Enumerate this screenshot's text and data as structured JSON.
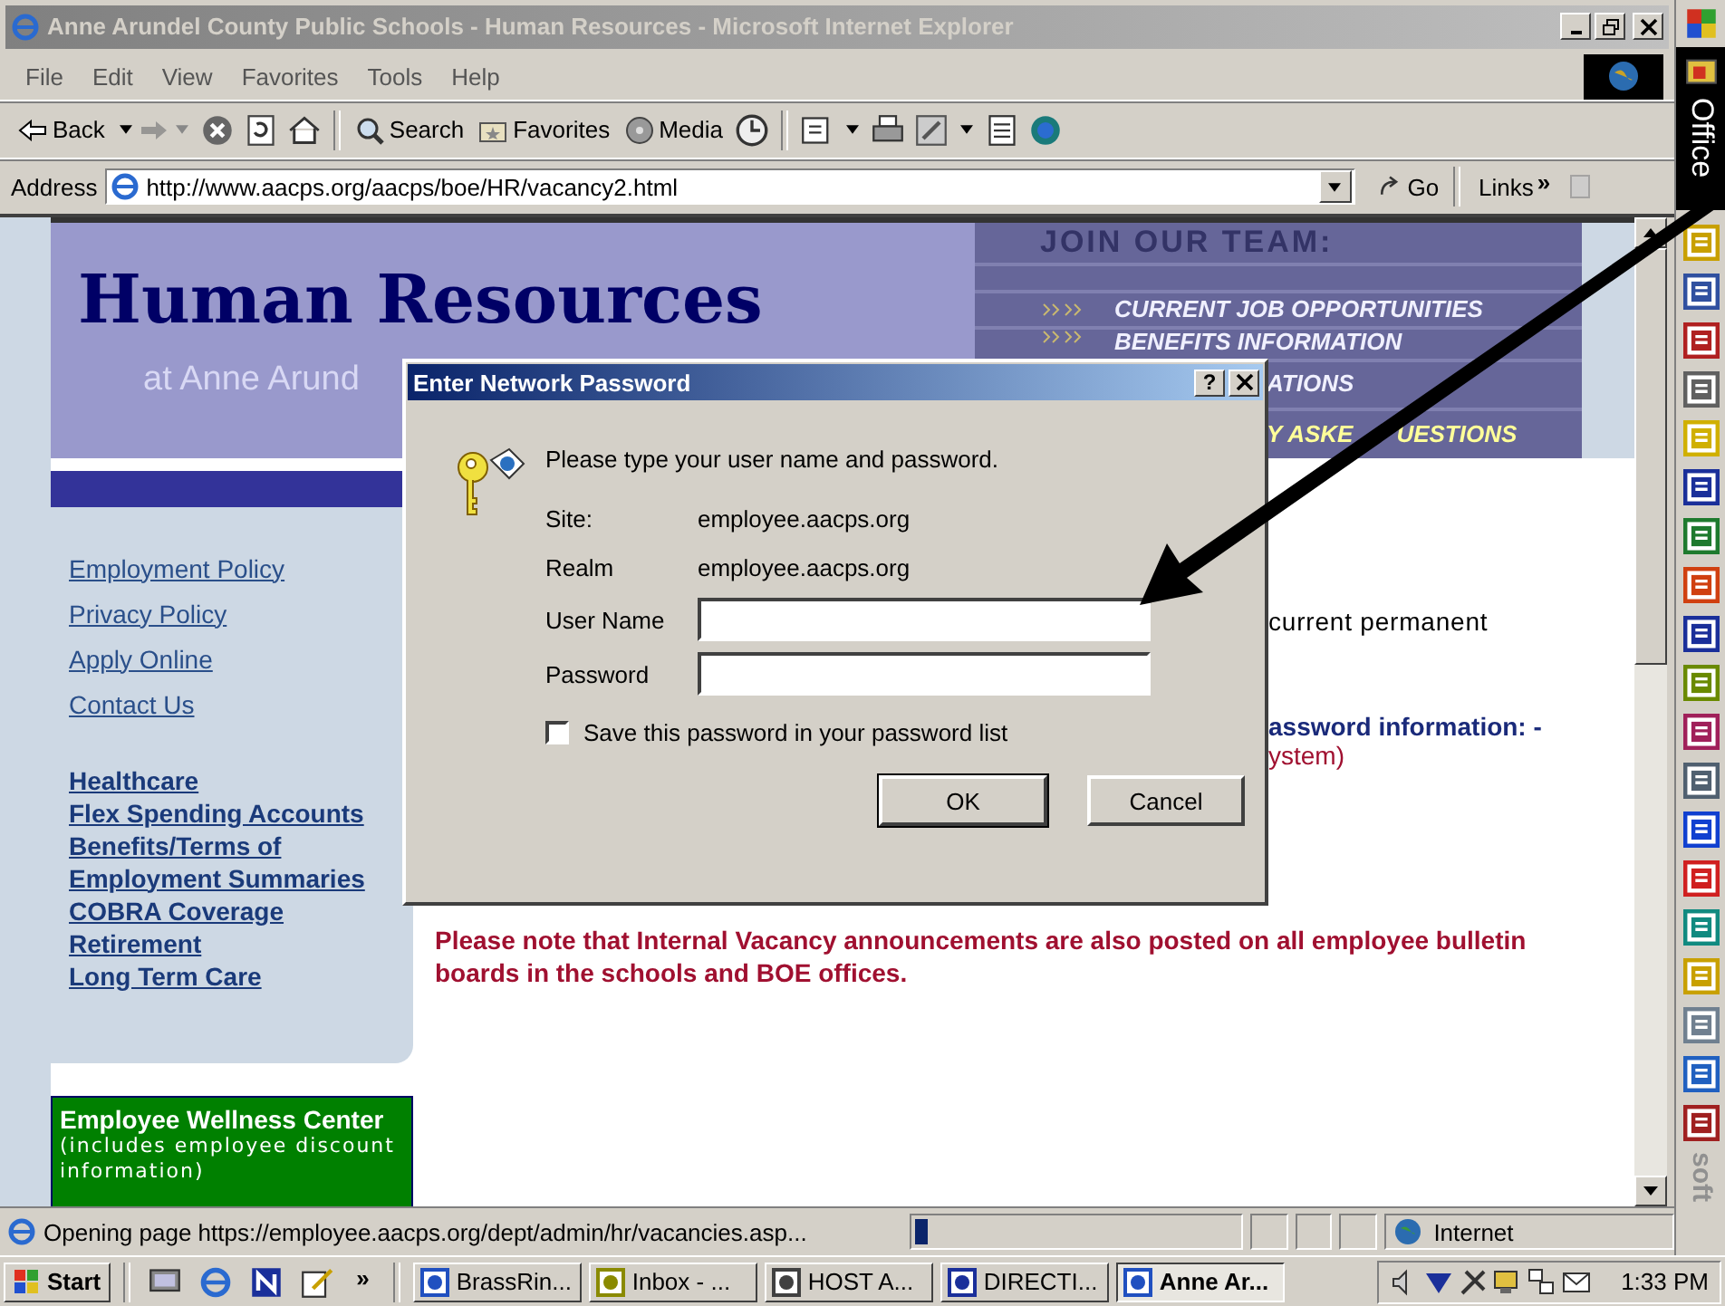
{
  "window": {
    "title": "Anne Arundel County Public Schools - Human Resources - Microsoft Internet Explorer"
  },
  "menu": [
    "File",
    "Edit",
    "View",
    "Favorites",
    "Tools",
    "Help"
  ],
  "toolbar": {
    "back": "Back",
    "search": "Search",
    "favorites": "Favorites",
    "media": "Media"
  },
  "address_bar": {
    "label": "Address",
    "url": "http://www.aacps.org/aacps/boe/HR/vacancy2.html",
    "go": "Go",
    "links": "Links",
    "more": "»"
  },
  "page": {
    "title": "Human Resources",
    "subtitle": "at Anne Arund",
    "join_heading": "JOIN OUR TEAM:",
    "join_links": [
      "CURRENT JOB OPPORTUNITIES",
      "BENEFITS INFORMATION",
      "ATIONS",
      "Y ASKE"
    ],
    "join_link_tail": "UESTIONS",
    "sidebar_links": [
      "Employment Policy",
      "Privacy Policy",
      "Apply Online",
      "Contact Us"
    ],
    "benefit_links": [
      "Healthcare",
      "Flex Spending Accounts",
      "Benefits/Terms of Employment Summaries",
      "COBRA Coverage",
      "Retirement",
      "Long Term Care"
    ],
    "wellness": {
      "title": "Employee Wellness Center",
      "text": "(includes employee discount information)"
    },
    "fragments": {
      "positions": "current permanent",
      "password_info": "assword information: -",
      "system": "ystem)"
    },
    "notice": "Please note that Internal Vacancy announcements are also posted on all employee bulletin boards in the schools and BOE offices."
  },
  "dialog": {
    "title": "Enter Network Password",
    "help": "?",
    "prompt": "Please type your user name and password.",
    "info": [
      {
        "label": "Site:",
        "value": "employee.aacps.org"
      },
      {
        "label": "Realm",
        "value": "employee.aacps.org"
      }
    ],
    "username_label": "User Name",
    "password_label": "Password",
    "save": {
      "label": "Save this password in your password list",
      "checked": false
    },
    "buttons": [
      "OK",
      "Cancel"
    ]
  },
  "status_bar": {
    "text": "Opening page https://employee.aacps.org/dept/admin/hr/vacancies.asp...",
    "progress": {
      "level": 0.04
    },
    "zone": "Internet"
  },
  "office_bar": {
    "label": "Office",
    "bottom_label": "soft"
  },
  "taskbar": {
    "start": "Start",
    "more": "»",
    "tasks": [
      {
        "label": "BrassRin...",
        "selected": false
      },
      {
        "label": "Inbox - ...",
        "selected": false
      },
      {
        "label": "HOST A...",
        "selected": false
      },
      {
        "label": "DIRECTI...",
        "selected": false
      },
      {
        "label": "Anne Ar...",
        "selected": true
      }
    ],
    "clock": "1:33 PM"
  }
}
